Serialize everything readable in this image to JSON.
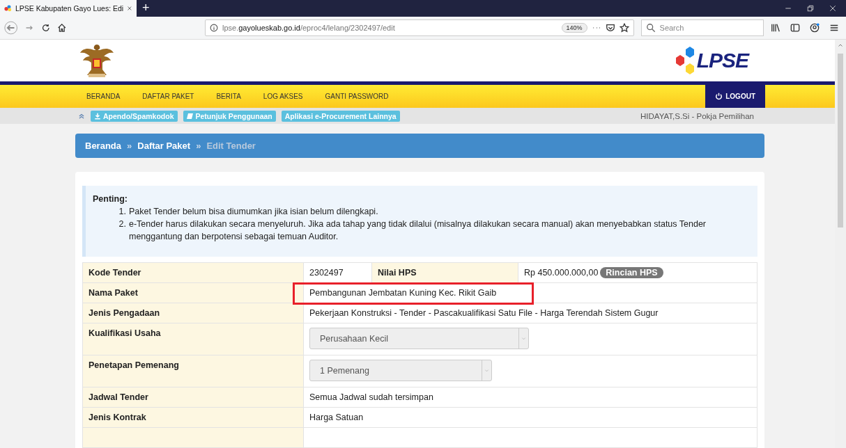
{
  "browser": {
    "tab": {
      "title": "LPSE Kabupaten Gayo Lues: Edi",
      "new_tab": "+"
    },
    "url": {
      "host_prefix": "lpse.",
      "host": "gayolueskab.go.id",
      "path": "/eproc4/lelang/2302497/edit"
    },
    "zoom": "140%",
    "search": {
      "placeholder": "Search"
    }
  },
  "header": {
    "logo_text": "LPSE"
  },
  "nav": {
    "items": [
      "BERANDA",
      "DAFTAR PAKET",
      "BERITA",
      "LOG AKSES",
      "GANTI PASSWORD"
    ],
    "logout": "LOGOUT"
  },
  "quick_links": [
    {
      "label": "Apendo/Spamkodok"
    },
    {
      "label": "Petunjuk Penggunaan"
    },
    {
      "label": "Aplikasi e-Procurement Lainnya"
    }
  ],
  "user": "HIDAYAT,S.Si - Pokja Pemilihan",
  "breadcrumb": [
    {
      "label": "Beranda",
      "current": false
    },
    {
      "prefix": "»",
      "label": "Daftar Paket",
      "current": false
    },
    {
      "prefix": "»",
      "label": "Edit Tender",
      "current": true
    }
  ],
  "notice": {
    "title": "Penting:",
    "items": [
      {
        "number": "1.",
        "text": "Paket Tender belum bisa diumumkan jika isian belum dilengkapi."
      },
      {
        "number": "2.",
        "text": "e-Tender harus dilakukan secara menyeluruh. Jika ada tahap yang tidak dilalui (misalnya dilakukan secara manual) akan menyebabkan status Tender menggantung dan berpotensi sebagai temuan Auditor."
      }
    ]
  },
  "table": {
    "rows": [
      {
        "kind": "pair",
        "label": "Kode Tender",
        "value": "2302497",
        "label_2": "Nilai HPS",
        "value_2": "Rp 450.000.000,00",
        "badge": "Rincian HPS"
      },
      {
        "kind": "text",
        "label": "Nama Paket",
        "value": "Pembangunan Jembatan Kuning Kec. Rikit Gaib",
        "highlighted": true
      },
      {
        "kind": "text",
        "label": "Jenis Pengadaan",
        "value": "Pekerjaan Konstruksi - Tender - Pascakualifikasi Satu File - Harga Terendah Sistem Gugur"
      },
      {
        "kind": "select",
        "label": "Kualifikasi Usaha",
        "value": "Perusahaan Kecil",
        "disabled": true
      },
      {
        "kind": "select",
        "label": "Penetapan Pemenang",
        "value": "1 Pemenang",
        "disabled": true
      },
      {
        "kind": "text",
        "label": "Jadwal Tender",
        "value": "Semua Jadwal sudah tersimpan"
      },
      {
        "kind": "text",
        "label": "Jenis Kontrak",
        "value": "Harga Satuan"
      }
    ]
  }
}
